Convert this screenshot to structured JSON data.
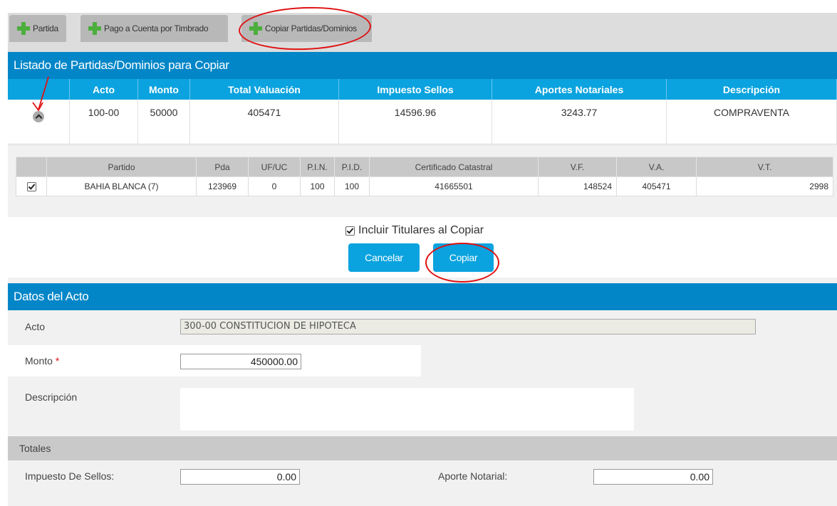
{
  "toolbar": {
    "btn_partida": "Partida",
    "btn_pago": "Pago a Cuenta por Timbrado",
    "btn_copiar": "Copiar Partidas/Dominios"
  },
  "listado": {
    "title": "Listado de Partidas/Dominios para Copiar",
    "headers": [
      "",
      "Acto",
      "Monto",
      "Total Valuación",
      "Impuesto Sellos",
      "Aportes Notariales",
      "Descripción"
    ],
    "row": {
      "acto": "100-00",
      "monto": "50000",
      "total": "405471",
      "sellos": "14596.96",
      "aportes": "3243.77",
      "descripcion": "COMPRAVENTA"
    }
  },
  "partidas": {
    "headers": [
      "",
      "Partido",
      "Pda",
      "UF/UC",
      "P.I.N.",
      "P.I.D.",
      "Certificado Catastral",
      "V.F.",
      "V.A.",
      "V.T."
    ],
    "row": {
      "partido": "BAHIA BLANCA (7)",
      "pda": "123969",
      "ufuc": "0",
      "pin": "100",
      "pid": "100",
      "certificado": "41665501",
      "vf": "148524",
      "va": "405471",
      "vt": "2998"
    }
  },
  "copy": {
    "incluir_label": "Incluir Titulares al Copiar",
    "cancelar": "Cancelar",
    "copiar": "Copiar"
  },
  "datos": {
    "title": "Datos del Acto",
    "acto_label": "Acto",
    "acto_value": "300-00 CONSTITUCION DE HIPOTECA",
    "monto_label": "Monto",
    "monto_required": "*",
    "monto_value": "450000.00",
    "descripcion_label": "Descripción",
    "descripcion_value": ""
  },
  "totales": {
    "title": "Totales",
    "impuesto_label": "Impuesto De Sellos:",
    "impuesto_value": "0.00",
    "aporte_label": "Aporte Notarial:",
    "aporte_value": "0.00"
  },
  "colors": {
    "header_blue": "#0386c8",
    "table_blue": "#0aa3df",
    "plus_green": "#4cae3c",
    "annotation_red": "#e01010"
  }
}
